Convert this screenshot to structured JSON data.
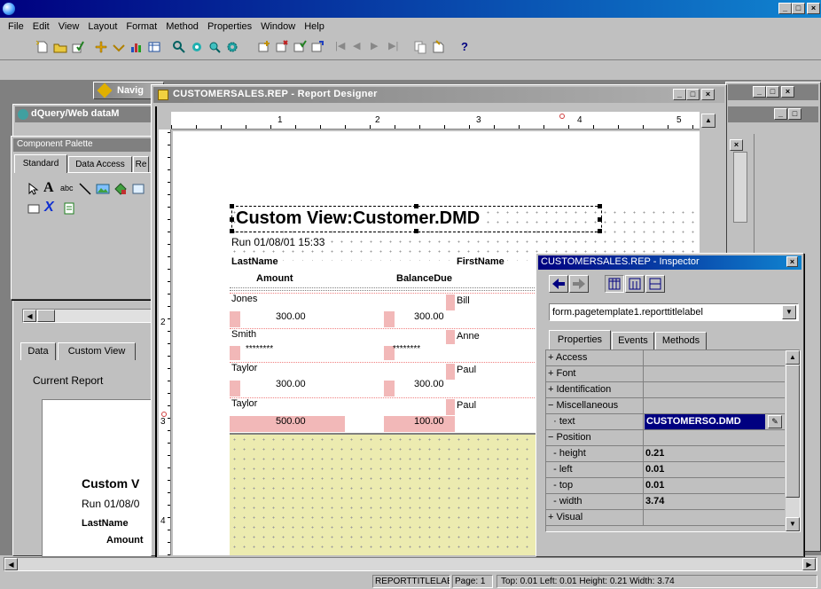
{
  "app": {
    "menu": [
      "File",
      "Edit",
      "View",
      "Layout",
      "Format",
      "Method",
      "Properties",
      "Window",
      "Help"
    ]
  },
  "navigator": {
    "title": "Navig"
  },
  "dquery": {
    "title": "dQuery/Web dataM"
  },
  "palette": {
    "title": "Component Palette",
    "tabs": [
      "Standard",
      "Data Access",
      "Re"
    ]
  },
  "left_panel": {
    "tabs": [
      "Data",
      "Custom View"
    ],
    "current_report_label": "Current Report",
    "preview_title": "Custom V",
    "preview_run": "Run 01/08/0",
    "preview_lastname": "LastName",
    "preview_amount": "Amount"
  },
  "designer": {
    "title": "CUSTOMERSALES.REP - Report Designer",
    "ruler_h": [
      "1",
      "2",
      "3",
      "4",
      "5"
    ],
    "ruler_v": [
      "2",
      "3",
      "4"
    ],
    "report_title": "Custom View:Customer.DMD",
    "run_line": "Run 01/08/01 15:33",
    "headers": {
      "lastname": "LastName",
      "firstname": "FirstName",
      "amount": "Amount",
      "balancedue": "BalanceDue"
    },
    "rows": [
      {
        "last": "Jones",
        "first": "Bill",
        "amount": "300.00",
        "balance": "300.00"
      },
      {
        "last": "Smith",
        "first": "Anne",
        "amount": "********",
        "balance": "********"
      },
      {
        "last": "Taylor",
        "first": "Paul",
        "amount": "300.00",
        "balance": "300.00"
      },
      {
        "last": "Taylor",
        "first": "Paul",
        "amount": "500.00",
        "balance": "100.00"
      }
    ]
  },
  "inspector": {
    "title": "CUSTOMERSALES.REP - Inspector",
    "object": "form.pagetemplate1.reporttitlelabel",
    "tabs": [
      "Properties",
      "Events",
      "Methods"
    ],
    "rows": [
      {
        "key": "+ Access",
        "value": ""
      },
      {
        "key": "+ Font",
        "value": ""
      },
      {
        "key": "+ Identification",
        "value": ""
      },
      {
        "key": "− Miscellaneous",
        "value": ""
      },
      {
        "key": "  · text",
        "value": "CUSTOMERSO.DMD"
      },
      {
        "key": "− Position",
        "value": ""
      },
      {
        "key": "  - height",
        "value": "0.21"
      },
      {
        "key": "  - left",
        "value": "0.01"
      },
      {
        "key": "  - top",
        "value": "0.01"
      },
      {
        "key": "  - width",
        "value": "3.74"
      },
      {
        "key": "+ Visual",
        "value": ""
      }
    ]
  },
  "status": {
    "object": "REPORTTITLELABE",
    "page": "Page: 1",
    "coords": "Top: 0.01 Left: 0.01 Height: 0.21 Width: 3.74"
  },
  "colors": {
    "titlebar": "#000080",
    "titlebar_end": "#1084d0",
    "selected": "#000080",
    "footer": "#ecebb0"
  }
}
